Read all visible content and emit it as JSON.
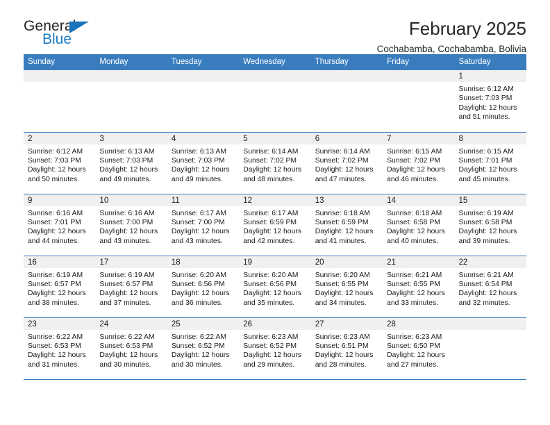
{
  "logo": {
    "word_top": "General",
    "word_bottom": "Blue",
    "accent_color": "#1a74bb"
  },
  "header": {
    "title": "February 2025",
    "subtitle": "Cochabamba, Cochabamba, Bolivia"
  },
  "theme": {
    "header_blue": "#3a7dbf",
    "daynum_gray": "#f0f0f0",
    "text": "#1a1a1a"
  },
  "weekday_headers": [
    "Sunday",
    "Monday",
    "Tuesday",
    "Wednesday",
    "Thursday",
    "Friday",
    "Saturday"
  ],
  "weeks": [
    [
      {
        "day": "",
        "sunrise": "",
        "sunset": "",
        "daylight_line1": "",
        "daylight_line2": ""
      },
      {
        "day": "",
        "sunrise": "",
        "sunset": "",
        "daylight_line1": "",
        "daylight_line2": ""
      },
      {
        "day": "",
        "sunrise": "",
        "sunset": "",
        "daylight_line1": "",
        "daylight_line2": ""
      },
      {
        "day": "",
        "sunrise": "",
        "sunset": "",
        "daylight_line1": "",
        "daylight_line2": ""
      },
      {
        "day": "",
        "sunrise": "",
        "sunset": "",
        "daylight_line1": "",
        "daylight_line2": ""
      },
      {
        "day": "",
        "sunrise": "",
        "sunset": "",
        "daylight_line1": "",
        "daylight_line2": ""
      },
      {
        "day": "1",
        "sunrise": "Sunrise: 6:12 AM",
        "sunset": "Sunset: 7:03 PM",
        "daylight_line1": "Daylight: 12 hours",
        "daylight_line2": "and 51 minutes."
      }
    ],
    [
      {
        "day": "2",
        "sunrise": "Sunrise: 6:12 AM",
        "sunset": "Sunset: 7:03 PM",
        "daylight_line1": "Daylight: 12 hours",
        "daylight_line2": "and 50 minutes."
      },
      {
        "day": "3",
        "sunrise": "Sunrise: 6:13 AM",
        "sunset": "Sunset: 7:03 PM",
        "daylight_line1": "Daylight: 12 hours",
        "daylight_line2": "and 49 minutes."
      },
      {
        "day": "4",
        "sunrise": "Sunrise: 6:13 AM",
        "sunset": "Sunset: 7:03 PM",
        "daylight_line1": "Daylight: 12 hours",
        "daylight_line2": "and 49 minutes."
      },
      {
        "day": "5",
        "sunrise": "Sunrise: 6:14 AM",
        "sunset": "Sunset: 7:02 PM",
        "daylight_line1": "Daylight: 12 hours",
        "daylight_line2": "and 48 minutes."
      },
      {
        "day": "6",
        "sunrise": "Sunrise: 6:14 AM",
        "sunset": "Sunset: 7:02 PM",
        "daylight_line1": "Daylight: 12 hours",
        "daylight_line2": "and 47 minutes."
      },
      {
        "day": "7",
        "sunrise": "Sunrise: 6:15 AM",
        "sunset": "Sunset: 7:02 PM",
        "daylight_line1": "Daylight: 12 hours",
        "daylight_line2": "and 46 minutes."
      },
      {
        "day": "8",
        "sunrise": "Sunrise: 6:15 AM",
        "sunset": "Sunset: 7:01 PM",
        "daylight_line1": "Daylight: 12 hours",
        "daylight_line2": "and 45 minutes."
      }
    ],
    [
      {
        "day": "9",
        "sunrise": "Sunrise: 6:16 AM",
        "sunset": "Sunset: 7:01 PM",
        "daylight_line1": "Daylight: 12 hours",
        "daylight_line2": "and 44 minutes."
      },
      {
        "day": "10",
        "sunrise": "Sunrise: 6:16 AM",
        "sunset": "Sunset: 7:00 PM",
        "daylight_line1": "Daylight: 12 hours",
        "daylight_line2": "and 43 minutes."
      },
      {
        "day": "11",
        "sunrise": "Sunrise: 6:17 AM",
        "sunset": "Sunset: 7:00 PM",
        "daylight_line1": "Daylight: 12 hours",
        "daylight_line2": "and 43 minutes."
      },
      {
        "day": "12",
        "sunrise": "Sunrise: 6:17 AM",
        "sunset": "Sunset: 6:59 PM",
        "daylight_line1": "Daylight: 12 hours",
        "daylight_line2": "and 42 minutes."
      },
      {
        "day": "13",
        "sunrise": "Sunrise: 6:18 AM",
        "sunset": "Sunset: 6:59 PM",
        "daylight_line1": "Daylight: 12 hours",
        "daylight_line2": "and 41 minutes."
      },
      {
        "day": "14",
        "sunrise": "Sunrise: 6:18 AM",
        "sunset": "Sunset: 6:58 PM",
        "daylight_line1": "Daylight: 12 hours",
        "daylight_line2": "and 40 minutes."
      },
      {
        "day": "15",
        "sunrise": "Sunrise: 6:19 AM",
        "sunset": "Sunset: 6:58 PM",
        "daylight_line1": "Daylight: 12 hours",
        "daylight_line2": "and 39 minutes."
      }
    ],
    [
      {
        "day": "16",
        "sunrise": "Sunrise: 6:19 AM",
        "sunset": "Sunset: 6:57 PM",
        "daylight_line1": "Daylight: 12 hours",
        "daylight_line2": "and 38 minutes."
      },
      {
        "day": "17",
        "sunrise": "Sunrise: 6:19 AM",
        "sunset": "Sunset: 6:57 PM",
        "daylight_line1": "Daylight: 12 hours",
        "daylight_line2": "and 37 minutes."
      },
      {
        "day": "18",
        "sunrise": "Sunrise: 6:20 AM",
        "sunset": "Sunset: 6:56 PM",
        "daylight_line1": "Daylight: 12 hours",
        "daylight_line2": "and 36 minutes."
      },
      {
        "day": "19",
        "sunrise": "Sunrise: 6:20 AM",
        "sunset": "Sunset: 6:56 PM",
        "daylight_line1": "Daylight: 12 hours",
        "daylight_line2": "and 35 minutes."
      },
      {
        "day": "20",
        "sunrise": "Sunrise: 6:20 AM",
        "sunset": "Sunset: 6:55 PM",
        "daylight_line1": "Daylight: 12 hours",
        "daylight_line2": "and 34 minutes."
      },
      {
        "day": "21",
        "sunrise": "Sunrise: 6:21 AM",
        "sunset": "Sunset: 6:55 PM",
        "daylight_line1": "Daylight: 12 hours",
        "daylight_line2": "and 33 minutes."
      },
      {
        "day": "22",
        "sunrise": "Sunrise: 6:21 AM",
        "sunset": "Sunset: 6:54 PM",
        "daylight_line1": "Daylight: 12 hours",
        "daylight_line2": "and 32 minutes."
      }
    ],
    [
      {
        "day": "23",
        "sunrise": "Sunrise: 6:22 AM",
        "sunset": "Sunset: 6:53 PM",
        "daylight_line1": "Daylight: 12 hours",
        "daylight_line2": "and 31 minutes."
      },
      {
        "day": "24",
        "sunrise": "Sunrise: 6:22 AM",
        "sunset": "Sunset: 6:53 PM",
        "daylight_line1": "Daylight: 12 hours",
        "daylight_line2": "and 30 minutes."
      },
      {
        "day": "25",
        "sunrise": "Sunrise: 6:22 AM",
        "sunset": "Sunset: 6:52 PM",
        "daylight_line1": "Daylight: 12 hours",
        "daylight_line2": "and 30 minutes."
      },
      {
        "day": "26",
        "sunrise": "Sunrise: 6:23 AM",
        "sunset": "Sunset: 6:52 PM",
        "daylight_line1": "Daylight: 12 hours",
        "daylight_line2": "and 29 minutes."
      },
      {
        "day": "27",
        "sunrise": "Sunrise: 6:23 AM",
        "sunset": "Sunset: 6:51 PM",
        "daylight_line1": "Daylight: 12 hours",
        "daylight_line2": "and 28 minutes."
      },
      {
        "day": "28",
        "sunrise": "Sunrise: 6:23 AM",
        "sunset": "Sunset: 6:50 PM",
        "daylight_line1": "Daylight: 12 hours",
        "daylight_line2": "and 27 minutes."
      },
      {
        "day": "",
        "sunrise": "",
        "sunset": "",
        "daylight_line1": "",
        "daylight_line2": ""
      }
    ]
  ]
}
